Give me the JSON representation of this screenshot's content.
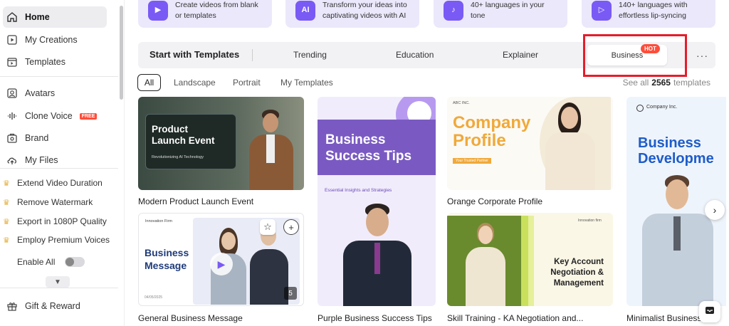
{
  "sidebar": {
    "nav": [
      {
        "label": "Home",
        "icon": "home-icon"
      },
      {
        "label": "My Creations",
        "icon": "play-square-icon"
      },
      {
        "label": "Templates",
        "icon": "templates-icon"
      },
      {
        "label": "Avatars",
        "icon": "avatar-icon"
      },
      {
        "label": "Clone Voice",
        "icon": "voice-wave-icon",
        "badge": "FREE"
      },
      {
        "label": "Brand",
        "icon": "brand-icon"
      },
      {
        "label": "My Files",
        "icon": "cloud-upload-icon"
      }
    ],
    "pro_features": [
      "Extend Video Duration",
      "Remove Watermark",
      "Export in 1080P Quality",
      "Employ Premium Voices"
    ],
    "enable_all": "Enable All",
    "gift": "Gift & Reward"
  },
  "feature_cards": [
    {
      "text": "Create videos from blank\nor templates"
    },
    {
      "text": "Transform your ideas into\ncaptivating videos with AI"
    },
    {
      "text": "40+ languages in your\ntone"
    },
    {
      "text": "140+ languages with\neffortless lip-syncing"
    }
  ],
  "templates_bar": {
    "title": "Start with Templates",
    "tabs": [
      "Trending",
      "Education",
      "Explainer",
      "Business"
    ],
    "hot": "HOT",
    "more": "···"
  },
  "filters": [
    "All",
    "Landscape",
    "Portrait",
    "My Templates"
  ],
  "see_all": {
    "prefix": "See all",
    "count": "2565",
    "suffix": "templates"
  },
  "cards": [
    {
      "label": "Modern Product Launch Event",
      "title": "Product\nLaunch Event",
      "sub": "Revolutionizing AI Technology"
    },
    {
      "label": "General Business Message",
      "title": "Business\nMessage",
      "brand": "Innovation Firm",
      "date": "04/05/2025",
      "count": "5"
    },
    {
      "label": "Purple Business Success Tips",
      "title": "Business\nSuccess Tips",
      "sub": "Essential Insights and Strategies"
    },
    {
      "label": "Orange Corporate Profile",
      "title": "Company\nProfile",
      "brand": "ABC INC.",
      "sub": "Your Trusted Partner"
    },
    {
      "label": "Skill Training - KA Negotiation and...",
      "title": "Key Account\nNegotiation &\nManagement",
      "brand": "Innovation firm"
    },
    {
      "label": "Minimalist Business...",
      "title": "Business\nDevelopme",
      "brand": "Company Inc."
    }
  ],
  "colors": {
    "accent": "#7a5af5",
    "hot": "#ff4d3a",
    "highlight": "#e61d2a"
  }
}
